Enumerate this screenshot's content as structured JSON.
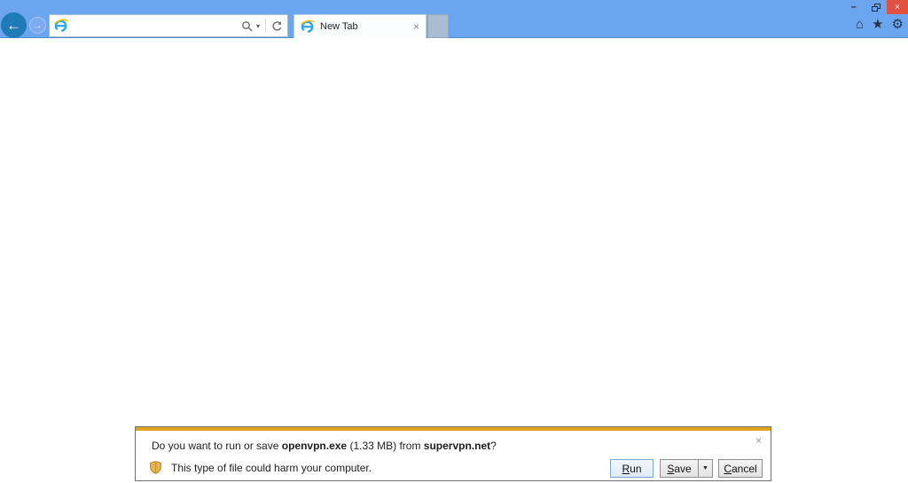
{
  "window": {
    "controls": {
      "minimize": "–",
      "close": "×"
    }
  },
  "toolbar": {
    "address": {
      "value": "",
      "placeholder": ""
    },
    "icons": {
      "back": "←",
      "forward": "→",
      "search_caret": "▾"
    }
  },
  "tabs": [
    {
      "label": "New Tab",
      "close": "×"
    }
  ],
  "nav_icons": {
    "home": "⌂",
    "favorites": "★",
    "tools": "⚙"
  },
  "download_bar": {
    "message": {
      "prefix": "Do you want to run or save ",
      "file": "openvpn.exe",
      "middle": " (1.33 MB) from ",
      "host": "supervpn.net",
      "suffix": "?"
    },
    "warning": "This type of file could harm your computer.",
    "close": "×",
    "buttons": {
      "run_key": "R",
      "run_rest": "un",
      "save_key": "S",
      "save_rest": "ave",
      "save_caret": "▼",
      "cancel_key": "C",
      "cancel_rest": "ancel"
    }
  },
  "colors": {
    "chrome_blue": "#6BA5EF",
    "accent_gold": "#E2A21B",
    "close_red": "#E25044",
    "back_circle": "#1F7BB8"
  }
}
